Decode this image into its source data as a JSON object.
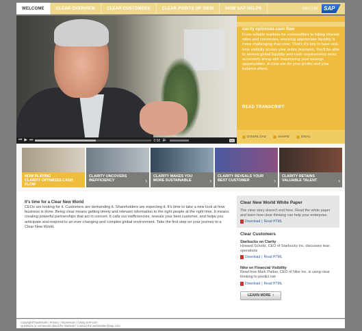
{
  "nav": {
    "tabs": [
      {
        "label": "WELCOME"
      },
      {
        "label": "CLEAR OVERVIEW"
      },
      {
        "label": "CLEAR CUSTOMERS"
      },
      {
        "label": "CLEAR POINTS OF VIEW"
      },
      {
        "label": "HOW SAP HELPS"
      }
    ],
    "site_link": "SAP.COM",
    "logo_text": "SAP"
  },
  "player": {
    "time": "0:58",
    "progress": 0.52,
    "cc": "CC"
  },
  "side": {
    "title": "clarity optimizes cash flow",
    "body": "From volatile markets for commodities to falling interest rates and currencies, ensuring appropriate liquidity is more challenging than ever. That's it's key to have real-time visibility across your entire business. You'll be able to assess global liquidity and cash requirements more accurately along with maximizing your savings opportunities. A clear win for your profits and your balance sheet.",
    "read_transcript": "READ TRANSCRIPT",
    "actions": {
      "download": "DOWNLOAD",
      "share": "SHARE",
      "email": "EMAIL"
    }
  },
  "thumbs": {
    "now_playing": "NOW PLAYING",
    "items": [
      {
        "label": "CLARITY OPTIMIZES CASH FLOW"
      },
      {
        "label": "CLARITY UNCOVERS INEFFICIENCY"
      },
      {
        "label": "CLARITY MAKES YOU MORE SUSTAINABLE"
      },
      {
        "label": "CLARITY REVEALS YOUR BEST CUSTOMER"
      },
      {
        "label": "CLARITY RETAINS VALUABLE TALENT"
      }
    ]
  },
  "intro": {
    "title": "It's time for a Clear New World",
    "body": "CEOs are looking for it. Customers are demanding it. Shareholders are expecting it. It's time to take a new look at how business is done. Being clear means getting timely and relevant information to the right people at the right time. It means creating powerful partnerships that act in concert. It calls out inefficiencies, reveals your best customer, and helps you anticipate and respond to an ever-changing and complex global environment. Take the first step on your journey to a Clear New World."
  },
  "whitepaper": {
    "title": "Clear New World White Paper",
    "body": "The clear story doesn't end here. Read the white paper and learn how clear thinking can help your enterprise.",
    "download": "Download",
    "read": "Read HTML"
  },
  "customers": {
    "title": "Clear Customers",
    "items": [
      {
        "title": "Starbucks on Clarity",
        "body": "Howard Schultz, CEO of Starbucks Inc. discusses lean operations",
        "download": "Download",
        "read": "Read HTML"
      },
      {
        "title": "Nike on Financial Visibility",
        "body": "Read how Mark Parker, CEO of Nike Inc. is using clear thinking to predict risk",
        "download": "Download",
        "read": "Read HTML"
      }
    ],
    "learn_more": "LEARN MORE"
  },
  "footer": {
    "line1": "Copyright/Trademark | Privacy | Impressum | Using SAP.com",
    "line2": "Questions or comments about the Website? Contact the webmaster@sap.com"
  },
  "colors": {
    "accent": "#eebd3d",
    "nav": "#eed88b"
  }
}
